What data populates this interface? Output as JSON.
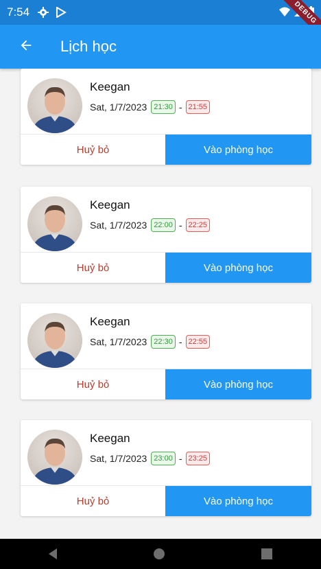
{
  "status_bar": {
    "time": "7:54",
    "debug_label": "DEBUG"
  },
  "app_bar": {
    "title": "Lịch học"
  },
  "colors": {
    "app_bar": "#2196f3",
    "status_bar": "#1b7fd3",
    "cancel_text": "#c0392b",
    "start_chip": "#4caf50",
    "end_chip": "#e35a5a"
  },
  "lessons": [
    {
      "name": "Keegan",
      "date": "Sat, 1/7/2023",
      "start": "21:30",
      "end": "21:55",
      "cancel_label": "Huỷ bỏ",
      "join_label": "Vào phòng học"
    },
    {
      "name": "Keegan",
      "date": "Sat, 1/7/2023",
      "start": "22:00",
      "end": "22:25",
      "cancel_label": "Huỷ bỏ",
      "join_label": "Vào phòng học"
    },
    {
      "name": "Keegan",
      "date": "Sat, 1/7/2023",
      "start": "22:30",
      "end": "22:55",
      "cancel_label": "Huỷ bỏ",
      "join_label": "Vào phòng học"
    },
    {
      "name": "Keegan",
      "date": "Sat, 1/7/2023",
      "start": "23:00",
      "end": "23:25",
      "cancel_label": "Huỷ bỏ",
      "join_label": "Vào phòng học"
    }
  ],
  "separator": "-",
  "icons": {
    "back": "arrow-back-icon",
    "settings": "gear-icon",
    "play": "play-protect-icon",
    "wifi": "wifi-icon",
    "signal": "signal-icon",
    "battery": "battery-icon"
  }
}
